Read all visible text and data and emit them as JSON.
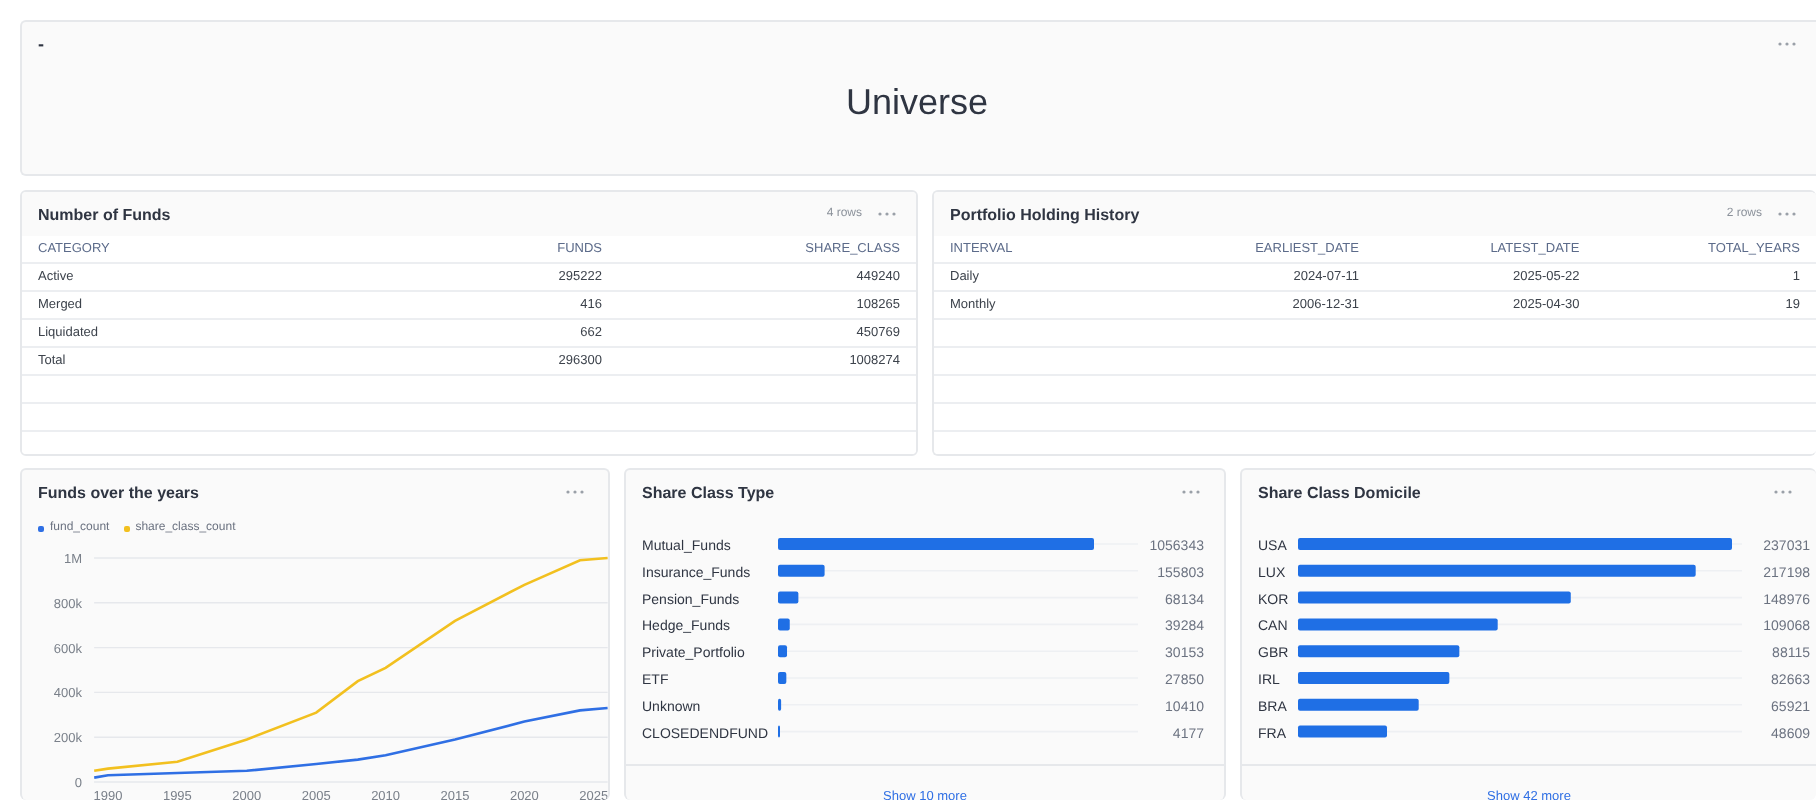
{
  "header": {
    "label": "-",
    "title": "Universe"
  },
  "funds_table": {
    "title": "Number of Funds",
    "row_count": "4 rows",
    "columns": [
      "CATEGORY",
      "FUNDS",
      "SHARE_CLASS"
    ],
    "rows": [
      [
        "Active",
        "295222",
        "449240"
      ],
      [
        "Merged",
        "416",
        "108265"
      ],
      [
        "Liquidated",
        "662",
        "450769"
      ],
      [
        "Total",
        "296300",
        "1008274"
      ]
    ]
  },
  "history_table": {
    "title": "Portfolio Holding History",
    "row_count": "2 rows",
    "columns": [
      "INTERVAL",
      "EARLIEST_DATE",
      "LATEST_DATE",
      "TOTAL_YEARS"
    ],
    "rows": [
      [
        "Daily",
        "2024-07-11",
        "2025-05-22",
        "1"
      ],
      [
        "Monthly",
        "2006-12-31",
        "2025-04-30",
        "19"
      ]
    ]
  },
  "line_card": {
    "title": "Funds over the years",
    "chart_data": {
      "type": "line",
      "grid": true,
      "xlim": [
        1989,
        2026
      ],
      "ylim": [
        0,
        1000000
      ],
      "x": [
        1989,
        1990,
        1995,
        2000,
        2005,
        2008,
        2010,
        2015,
        2020,
        2024,
        2026
      ],
      "series": [
        {
          "name": "fund_count",
          "color": "#2f6fe4",
          "values": [
            20000,
            30000,
            40000,
            50000,
            80000,
            100000,
            120000,
            190000,
            270000,
            320000,
            330000
          ]
        },
        {
          "name": "share_class_count",
          "color": "#f2c01f",
          "values": [
            50000,
            60000,
            90000,
            190000,
            310000,
            450000,
            510000,
            720000,
            880000,
            990000,
            1000000
          ]
        }
      ],
      "xticks": [
        1990,
        1995,
        2000,
        2005,
        2010,
        2015,
        2020,
        2025
      ],
      "yticks": [
        {
          "value": 0,
          "label": "0"
        },
        {
          "value": 200000,
          "label": "200k"
        },
        {
          "value": 400000,
          "label": "400k"
        },
        {
          "value": 600000,
          "label": "600k"
        },
        {
          "value": 800000,
          "label": "800k"
        },
        {
          "value": 1000000,
          "label": "1M"
        }
      ]
    }
  },
  "type_card": {
    "title": "Share Class Type",
    "chart_data": {
      "type": "bar",
      "orientation": "horizontal",
      "grid": true,
      "data_labels": true,
      "categories": [
        "Mutual_Funds",
        "Insurance_Funds",
        "Pension_Funds",
        "Hedge_Funds",
        "Private_Portfolio",
        "ETF",
        "Unknown",
        "CLOSEDENDFUND"
      ],
      "values": [
        1056343,
        155803,
        68134,
        39284,
        30153,
        27850,
        10410,
        4177
      ]
    },
    "show_more": "Show 10 more"
  },
  "domicile_card": {
    "title": "Share Class Domicile",
    "chart_data": {
      "type": "bar",
      "orientation": "horizontal",
      "grid": true,
      "data_labels": true,
      "categories": [
        "USA",
        "LUX",
        "KOR",
        "CAN",
        "GBR",
        "IRL",
        "BRA",
        "FRA"
      ],
      "values": [
        237031,
        217198,
        148976,
        109068,
        88115,
        82663,
        65921,
        48609
      ]
    },
    "show_more": "Show 42 more"
  }
}
